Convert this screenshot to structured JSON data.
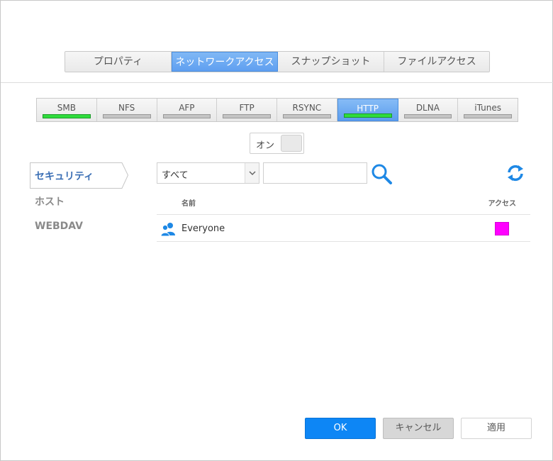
{
  "top_tabs": [
    {
      "label": "プロパティ",
      "active": false
    },
    {
      "label": "ネットワークアクセス",
      "active": true
    },
    {
      "label": "スナップショット",
      "active": false
    },
    {
      "label": "ファイルアクセス",
      "active": false
    }
  ],
  "protocol_tabs": [
    {
      "label": "SMB",
      "status": "on"
    },
    {
      "label": "NFS",
      "status": "off"
    },
    {
      "label": "AFP",
      "status": "off"
    },
    {
      "label": "FTP",
      "status": "off"
    },
    {
      "label": "RSYNC",
      "status": "off"
    },
    {
      "label": "HTTP",
      "status": "on",
      "active": true
    },
    {
      "label": "DLNA",
      "status": "off"
    },
    {
      "label": "iTunes",
      "status": "off"
    }
  ],
  "toggle": {
    "label": "オン"
  },
  "side_nav": {
    "items": [
      {
        "label": "セキュリティ",
        "active": true
      },
      {
        "label": "ホスト"
      },
      {
        "label": "WEBDAV"
      }
    ]
  },
  "filter": {
    "select_value": "すべて",
    "search_value": ""
  },
  "table": {
    "headers": {
      "name": "名前",
      "access": "アクセス"
    },
    "rows": [
      {
        "name": "Everyone",
        "access_color": "#ff00ff"
      }
    ]
  },
  "footer": {
    "ok_label": "OK",
    "cancel_label": "キャンセル",
    "apply_label": "適用"
  },
  "colors": {
    "accent": "#0d86f5",
    "tab_active": "#5f9ff0",
    "status_on": "#2fdc3c",
    "nav_active": "#3b6fb5"
  }
}
